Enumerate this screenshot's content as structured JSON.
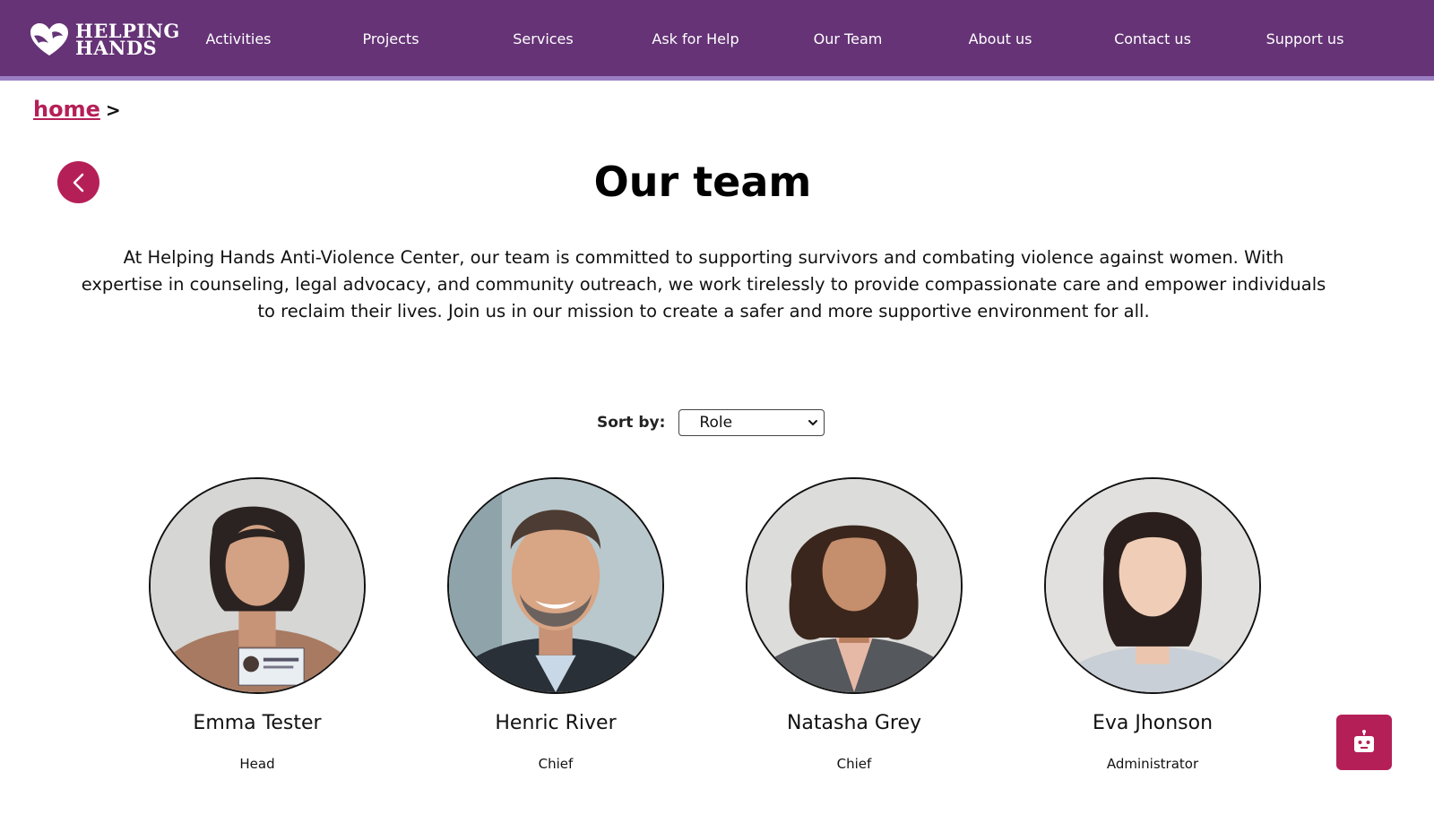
{
  "brand": {
    "line1": "HELPING",
    "line2": "HANDS"
  },
  "nav": {
    "items": [
      {
        "label": "Activities"
      },
      {
        "label": "Projects"
      },
      {
        "label": "Services"
      },
      {
        "label": "Ask for Help"
      },
      {
        "label": "Our Team"
      },
      {
        "label": "About us"
      },
      {
        "label": "Contact us"
      },
      {
        "label": "Support us"
      }
    ]
  },
  "breadcrumb": {
    "home": "home",
    "separator": ">"
  },
  "page": {
    "title": "Our team",
    "intro": "At Helping Hands Anti-Violence Center, our team is committed to supporting survivors and combating violence against women. With expertise in counseling, legal advocacy, and community outreach, we work tirelessly to provide compassionate care and empower individuals to reclaim their lives. Join us in our mission to create a safer and more supportive environment for all."
  },
  "sort": {
    "label": "Sort by:",
    "selected": "Role"
  },
  "team": [
    {
      "name": "Emma Tester",
      "role": "Head"
    },
    {
      "name": "Henric River",
      "role": "Chief"
    },
    {
      "name": "Natasha Grey",
      "role": "Chief"
    },
    {
      "name": "Eva Jhonson",
      "role": "Administrator"
    }
  ],
  "colors": {
    "header": "#653376",
    "header_underline": "#9b7fc4",
    "accent": "#b51f57"
  }
}
